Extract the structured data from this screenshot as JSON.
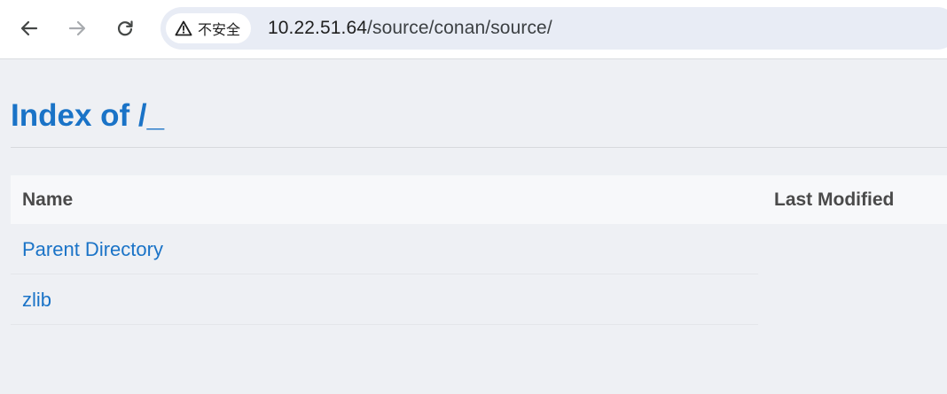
{
  "browser": {
    "security_label": "不安全",
    "url_host": "10.22.51.64",
    "url_path": "/source/conan/source/"
  },
  "page": {
    "heading": "Index of /_",
    "columns": {
      "name": "Name",
      "last_modified": "Last Modified"
    },
    "entries": [
      {
        "name": "Parent Directory"
      },
      {
        "name": "zlib"
      }
    ]
  },
  "colors": {
    "link": "#1a73c7",
    "background": "#eef0f4"
  }
}
